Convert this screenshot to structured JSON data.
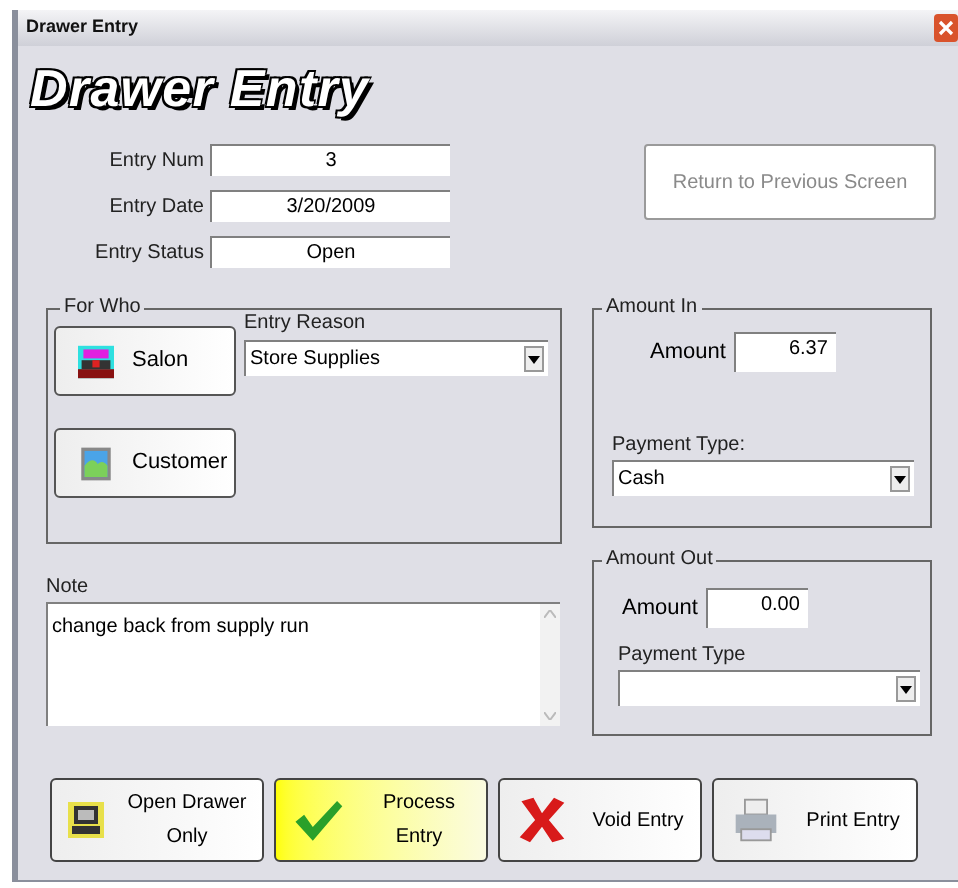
{
  "window": {
    "title": "Drawer Entry"
  },
  "heading": "Drawer Entry",
  "fields": [
    {
      "label": "Entry Num",
      "value": "3"
    },
    {
      "label": "Entry Date",
      "value": "3/20/2009"
    },
    {
      "label": "Entry Status",
      "value": "Open"
    }
  ],
  "return_button": {
    "label": "Return to Previous Screen",
    "disabled": true
  },
  "for_who": {
    "title": "For Who",
    "buttons": [
      {
        "kind": "salon",
        "label": "Salon"
      },
      {
        "kind": "customer",
        "label": "Customer"
      }
    ],
    "entry_reason": {
      "label": "Entry Reason",
      "value": "Store Supplies"
    }
  },
  "note": {
    "label": "Note",
    "value": "change back from supply run"
  },
  "amount_in": {
    "title": "Amount In",
    "amount_label": "Amount",
    "amount": "6.37",
    "payment_label": "Payment Type:",
    "payment_value": "Cash"
  },
  "amount_out": {
    "title": "Amount Out",
    "amount_label": "Amount",
    "amount": "0.00",
    "payment_label": "Payment Type"
  },
  "actions": [
    {
      "kind": "drawer",
      "label": "Open Drawer Only",
      "highlighted": false
    },
    {
      "kind": "process",
      "label": "Process Entry",
      "highlighted": true
    },
    {
      "kind": "void",
      "label": "Void Entry",
      "highlighted": false
    },
    {
      "kind": "print",
      "label": "Print Entry",
      "highlighted": false
    }
  ]
}
